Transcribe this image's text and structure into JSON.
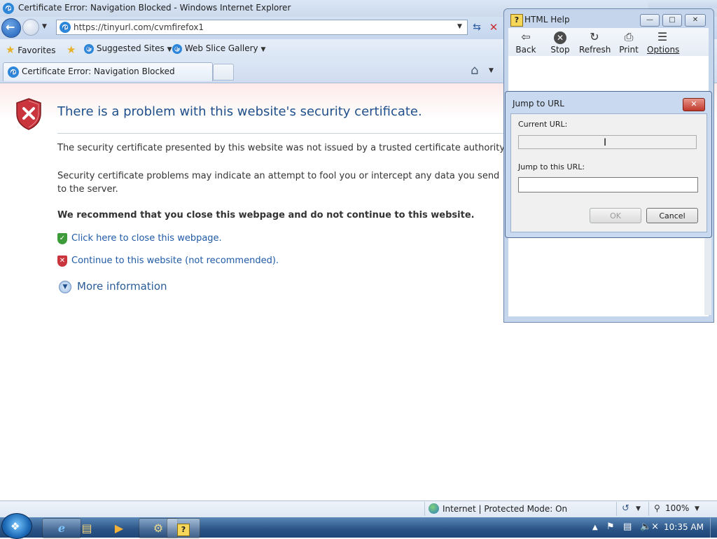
{
  "ie": {
    "window_title": "Certificate Error: Navigation Blocked - Windows Internet Explorer",
    "address_url": "https://tinyurl.com/cvmfirefox1",
    "favorites_label": "Favorites",
    "suggested_sites_label": "Suggested Sites",
    "web_slice_label": "Web Slice Gallery",
    "tab_label": "Certificate Error: Navigation Blocked"
  },
  "page": {
    "title": "There is a problem with this website's security certificate.",
    "para1": "The security certificate presented by this website was not issued by a trusted certificate authority.",
    "para2": "Security certificate problems may indicate an attempt to fool you or intercept any data you send to the server.",
    "recommend": "We recommend that you close this webpage and do not continue to this website.",
    "close_link": "Click here to close this webpage.",
    "continue_link": "Continue to this website (not recommended).",
    "more_info": "More information"
  },
  "status": {
    "zone": "Internet | Protected Mode: On",
    "zoom": "100%"
  },
  "taskbar": {
    "clock": "10:35 AM"
  },
  "help": {
    "title": "HTML Help",
    "buttons": {
      "back": "Back",
      "stop": "Stop",
      "refresh": "Refresh",
      "print": "Print",
      "options": "Options"
    }
  },
  "dialog": {
    "title": "Jump to URL",
    "current_label": "Current URL:",
    "current_value": "",
    "jump_label": "Jump to this URL:",
    "jump_value": "",
    "ok": "OK",
    "cancel": "Cancel"
  },
  "icons": {
    "error_shield": "error-shield-icon",
    "accent": "#1f4f8a",
    "link": "#1f5aa6",
    "error_red": "#c9343d",
    "ok_green": "#3d9b3a"
  }
}
